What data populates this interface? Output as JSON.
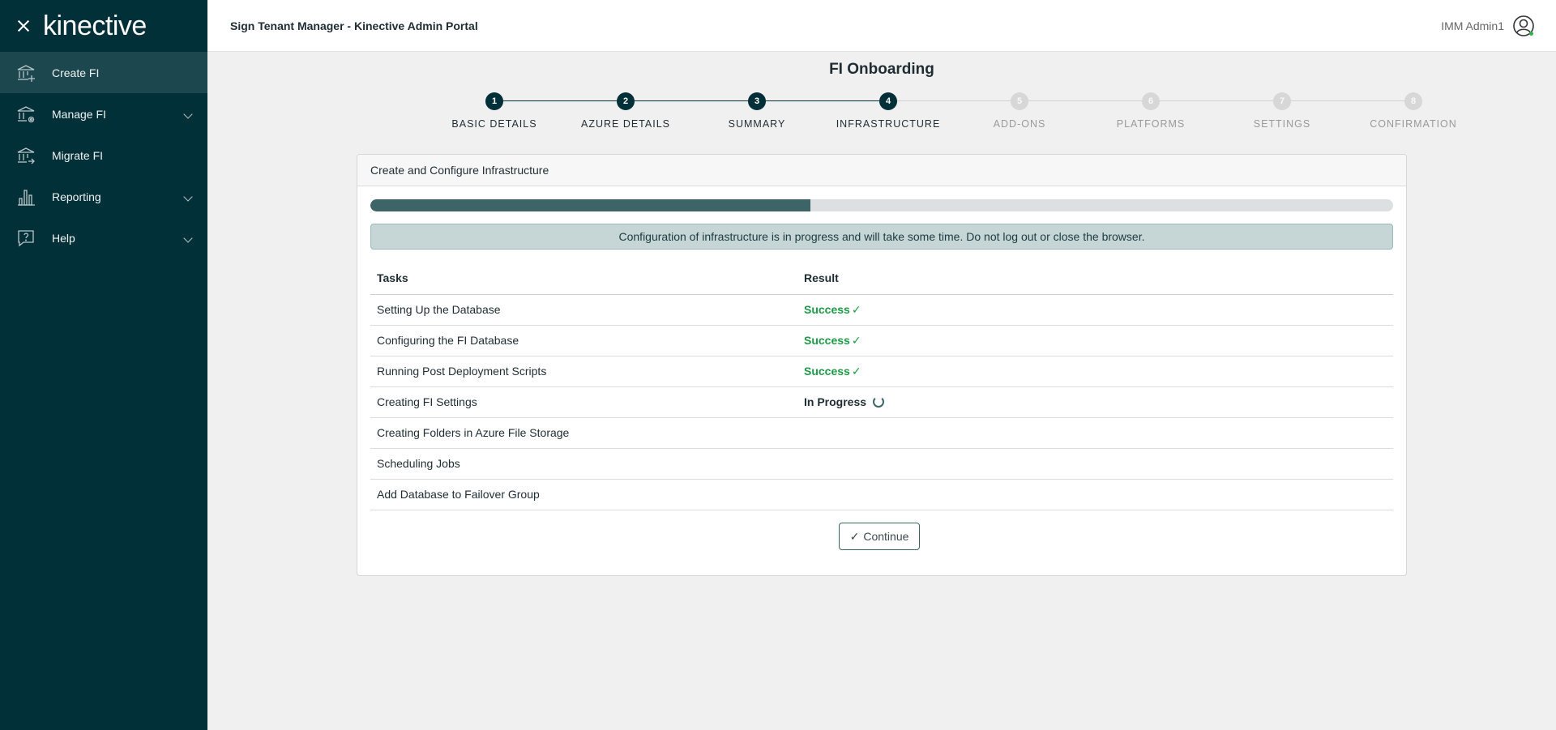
{
  "sidebar": {
    "logo": "kinective",
    "items": [
      {
        "label": "Create FI",
        "icon": "bank-add-icon",
        "active": true,
        "expandable": false
      },
      {
        "label": "Manage FI",
        "icon": "bank-settings-icon",
        "active": false,
        "expandable": true
      },
      {
        "label": "Migrate FI",
        "icon": "bank-migrate-icon",
        "active": false,
        "expandable": false
      },
      {
        "label": "Reporting",
        "icon": "bar-chart-icon",
        "active": false,
        "expandable": true
      },
      {
        "label": "Help",
        "icon": "help-bubble-icon",
        "active": false,
        "expandable": true
      }
    ]
  },
  "header": {
    "title": "Sign Tenant Manager - Kinective Admin Portal",
    "user_name": "IMM Admin1"
  },
  "page": {
    "title": "FI Onboarding"
  },
  "stepper": {
    "steps": [
      {
        "number": "1",
        "label": "BASIC DETAILS",
        "state": "complete"
      },
      {
        "number": "2",
        "label": "AZURE DETAILS",
        "state": "complete"
      },
      {
        "number": "3",
        "label": "SUMMARY",
        "state": "complete"
      },
      {
        "number": "4",
        "label": "INFRASTRUCTURE",
        "state": "current"
      },
      {
        "number": "5",
        "label": "ADD-ONS",
        "state": "inactive"
      },
      {
        "number": "6",
        "label": "PLATFORMS",
        "state": "inactive"
      },
      {
        "number": "7",
        "label": "SETTINGS",
        "state": "inactive"
      },
      {
        "number": "8",
        "label": "CONFIRMATION",
        "state": "inactive"
      }
    ]
  },
  "card": {
    "title": "Create and Configure Infrastructure",
    "progress_fraction": 0.43,
    "alert": "Configuration of infrastructure is in progress and will take some time. Do not log out or close the browser.",
    "table": {
      "headers": [
        "Tasks",
        "Result"
      ],
      "rows": [
        {
          "task": "Setting Up the Database",
          "result": "Success",
          "status": "success"
        },
        {
          "task": "Configuring the FI Database",
          "result": "Success",
          "status": "success"
        },
        {
          "task": "Running Post Deployment Scripts",
          "result": "Success",
          "status": "success"
        },
        {
          "task": "Creating FI Settings",
          "result": "In Progress",
          "status": "in-progress"
        },
        {
          "task": "Creating Folders in Azure File Storage",
          "result": "",
          "status": "pending"
        },
        {
          "task": "Scheduling Jobs",
          "result": "",
          "status": "pending"
        },
        {
          "task": "Add Database to Failover Group",
          "result": "",
          "status": "pending"
        }
      ]
    },
    "continue_label": "Continue"
  },
  "colors": {
    "sidebar_bg": "#023038",
    "accent": "#3d6467",
    "success": "#1e9a47"
  }
}
